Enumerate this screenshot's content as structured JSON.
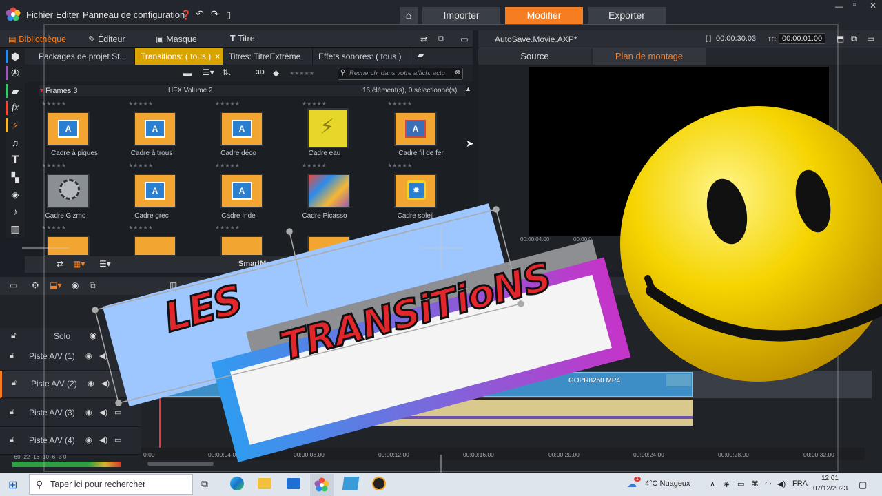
{
  "menu": {
    "file": "Fichier",
    "edit": "Editer",
    "control_panel": "Panneau de configuration"
  },
  "modes": {
    "import": "Importer",
    "edit": "Modifier",
    "export": "Exporter"
  },
  "library": {
    "tabs": {
      "library": "Bibliothèque",
      "editor": "Éditeur",
      "mask": "Masque",
      "title": "Titre"
    },
    "subtabs": [
      "Packages de projet St...",
      "Transitions: ( tous )",
      "Titres: TitreExtrême",
      "Effets sonores: ( tous )"
    ],
    "toolbar_3d": "3D",
    "search_placeholder": "Recherch. dans votre affich. actu",
    "group_name": "Frames 3",
    "group_volume": "HFX Volume 2",
    "group_count": "16 élément(s), 0 sélectionné(s)",
    "stars": "★★★★★",
    "items_row1": [
      "Cadre à piques",
      "Cadre à trous",
      "Cadre déco",
      "Cadre eau",
      "Cadre fil de fer"
    ],
    "items_row2": [
      "Cadre Gizmo",
      "Cadre grec",
      "Cadre Inde",
      "Cadre Picasso",
      "Cadre soleil"
    ],
    "footer_label": "SmartMovie"
  },
  "player": {
    "file": "AutoSave.Movie.AXP*",
    "duration": "00:00:30.03",
    "tc_label": "TC",
    "timecode": "00:00:01.00",
    "bracket": "[ ]",
    "tabs": {
      "source": "Source",
      "timeline": "Plan de montage"
    },
    "mini_ticks": [
      "00:00:04.00",
      "00:00:0"
    ]
  },
  "timeline": {
    "solo": "Solo",
    "tracks": [
      "Piste A/V (1)",
      "Piste A/V (2)",
      "Piste A/V (3)",
      "Piste A/V (4)"
    ],
    "clip_name": "GOPR8250.MP4",
    "ticks": [
      "0:00",
      "00:00:04.00",
      "00:00:08.00",
      "00:00:12.00",
      "00:00:16.00",
      "00:00:20.00",
      "00:00:24.00",
      "00:00:28.00",
      "00:00:32.00"
    ],
    "vu_scale": "-60   -22  -16   -10   -6   -3   0"
  },
  "overlay": {
    "line1": "LES",
    "line2": "TRANSiTioNS"
  },
  "taskbar": {
    "search": "Taper ici pour rechercher",
    "weather": "4°C  Nuageux",
    "lang": "FRA",
    "time": "12:01",
    "date": "07/12/2023",
    "weather_badge": "1"
  },
  "colors": {
    "accent": "#f47e21",
    "transition_tab": "#d9a400",
    "thumb": "#f3a531"
  }
}
